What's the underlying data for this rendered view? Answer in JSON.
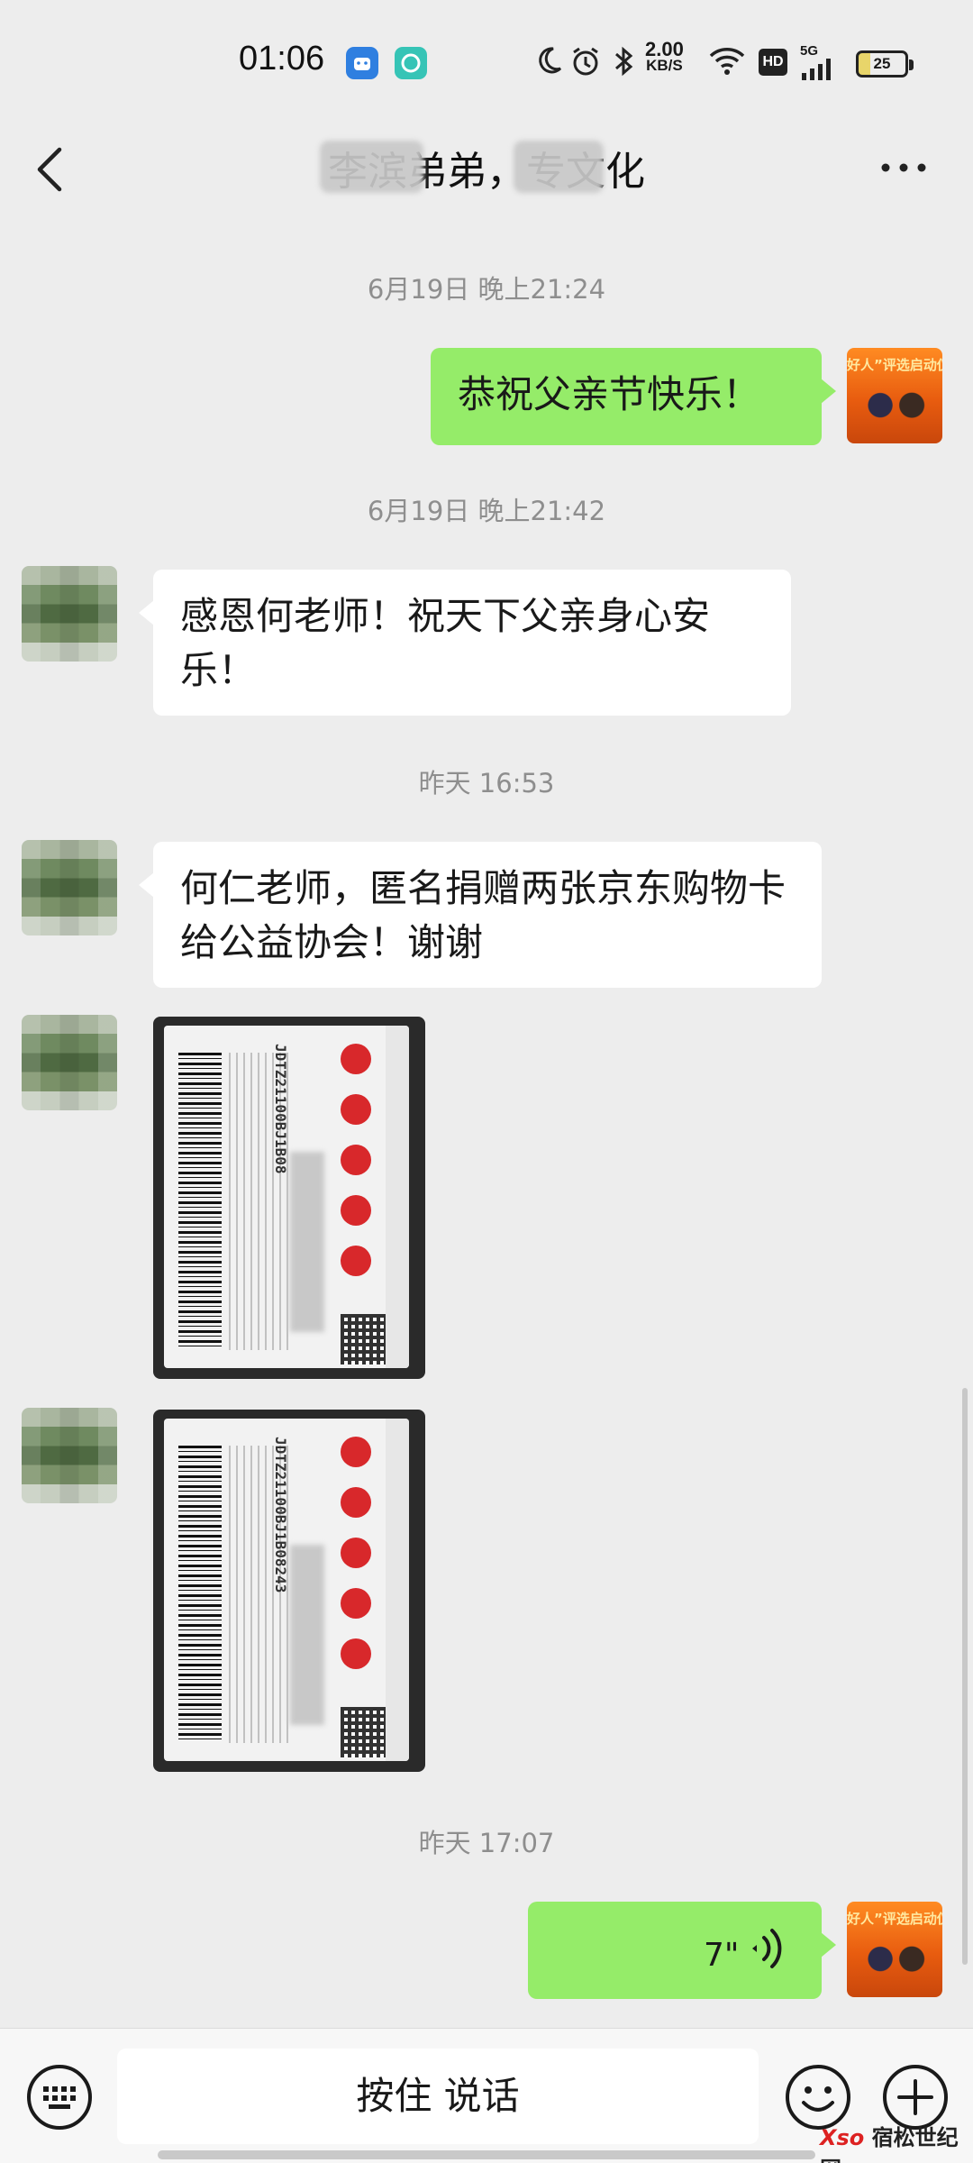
{
  "status_bar": {
    "time": "01:06",
    "net_speed_value": "2.00",
    "net_speed_unit": "KB/S",
    "hd_label": "HD",
    "network_label": "5G",
    "battery_level": "25"
  },
  "header": {
    "title": "李滨弟弟，专文化"
  },
  "messages": {
    "ts1": "6月19日 晚上21:24",
    "m1": "恭祝父亲节快乐！",
    "ts2": "6月19日 晚上21:42",
    "m2": "感恩何老师！祝天下父亲身心安乐！",
    "ts3": "昨天 16:53",
    "m3": "何仁老师，匿名捐赠两张京东购物卡给公益协会！谢谢",
    "card1_code": "JDTZ21100BJ1B08",
    "card2_code": "JDTZ21100BJ1B08243",
    "ts4": "昨天 17:07",
    "voice_duration": "7\""
  },
  "avatar_self_banner": "好人”评选启动仪",
  "input_bar": {
    "hold_to_talk": "按住 说话"
  },
  "watermark": {
    "logo": "Xso",
    "text": "宿松世纪网"
  },
  "colors": {
    "background": "#ededed",
    "bubble_out": "#95ec69",
    "bubble_in": "#ffffff",
    "timestamp": "#8e8e8e"
  }
}
